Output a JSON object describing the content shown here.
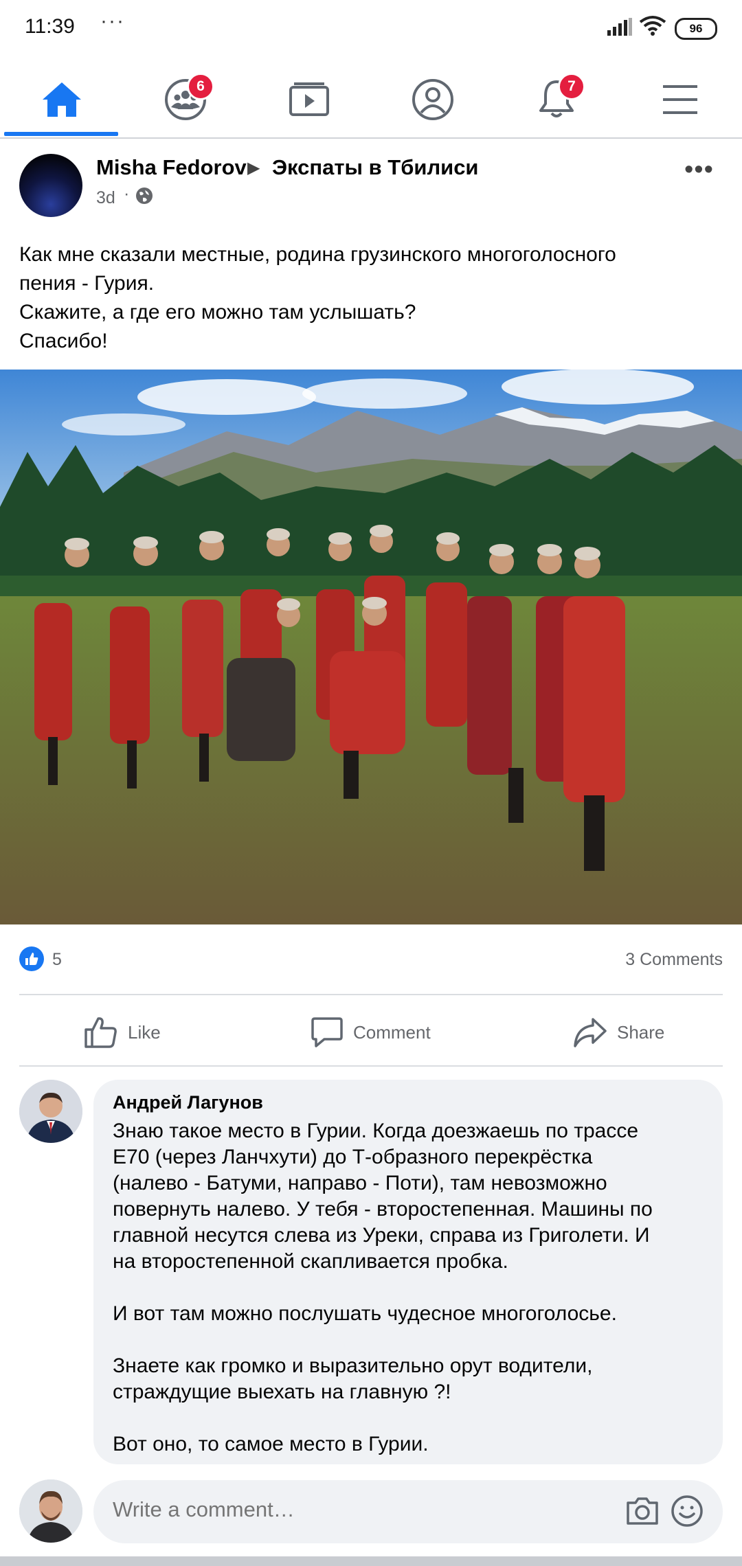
{
  "status_bar": {
    "time": "11:39",
    "dots": "···",
    "battery": "96"
  },
  "nav": {
    "items": [
      {
        "name": "home",
        "badge": null
      },
      {
        "name": "groups",
        "badge": "6"
      },
      {
        "name": "watch",
        "badge": null
      },
      {
        "name": "profile",
        "badge": null
      },
      {
        "name": "notifications",
        "badge": "7"
      },
      {
        "name": "menu",
        "badge": null
      }
    ],
    "active": "home",
    "accent_color": "#1877f2",
    "badge_color": "#e41e3f"
  },
  "post": {
    "author": "Misha Fedorov",
    "group": "Экспаты в Тбилиси",
    "time": "3d",
    "privacy_icon": "globe-icon",
    "text_lines": [
      "Как мне сказали местные, родина грузинского многоголосного",
      "пения - Гурия.",
      "Скажите, а где его можно там услышать?",
      "Спасибо!"
    ],
    "reaction_count": "5",
    "comments_count": "3 Comments",
    "actions": {
      "like": "Like",
      "comment": "Comment",
      "share": "Share"
    }
  },
  "comment": {
    "author": "Андрей Лагунов",
    "lines": [
      "Знаю такое место в Гурии. Когда доезжаешь по трассе",
      "E70 (через Ланчхути) до Т-образного перекрёстка",
      "(налево - Батуми, направо - Поти), там невозможно",
      "повернуть налево. У тебя - второстепенная. Машины по",
      "главной несутся слева из Уреки, справа из Григолети. И",
      "на второстепенной скапливается пробка.",
      "",
      "И вот там можно послушать чудесное многоголосье.",
      "",
      "Знаете как громко и выразительно орут водители,",
      "страждущие выехать на главную ?!",
      "",
      "Вот оно, то самое место в Гурии."
    ]
  },
  "write_comment": {
    "placeholder": "Write a comment…"
  }
}
